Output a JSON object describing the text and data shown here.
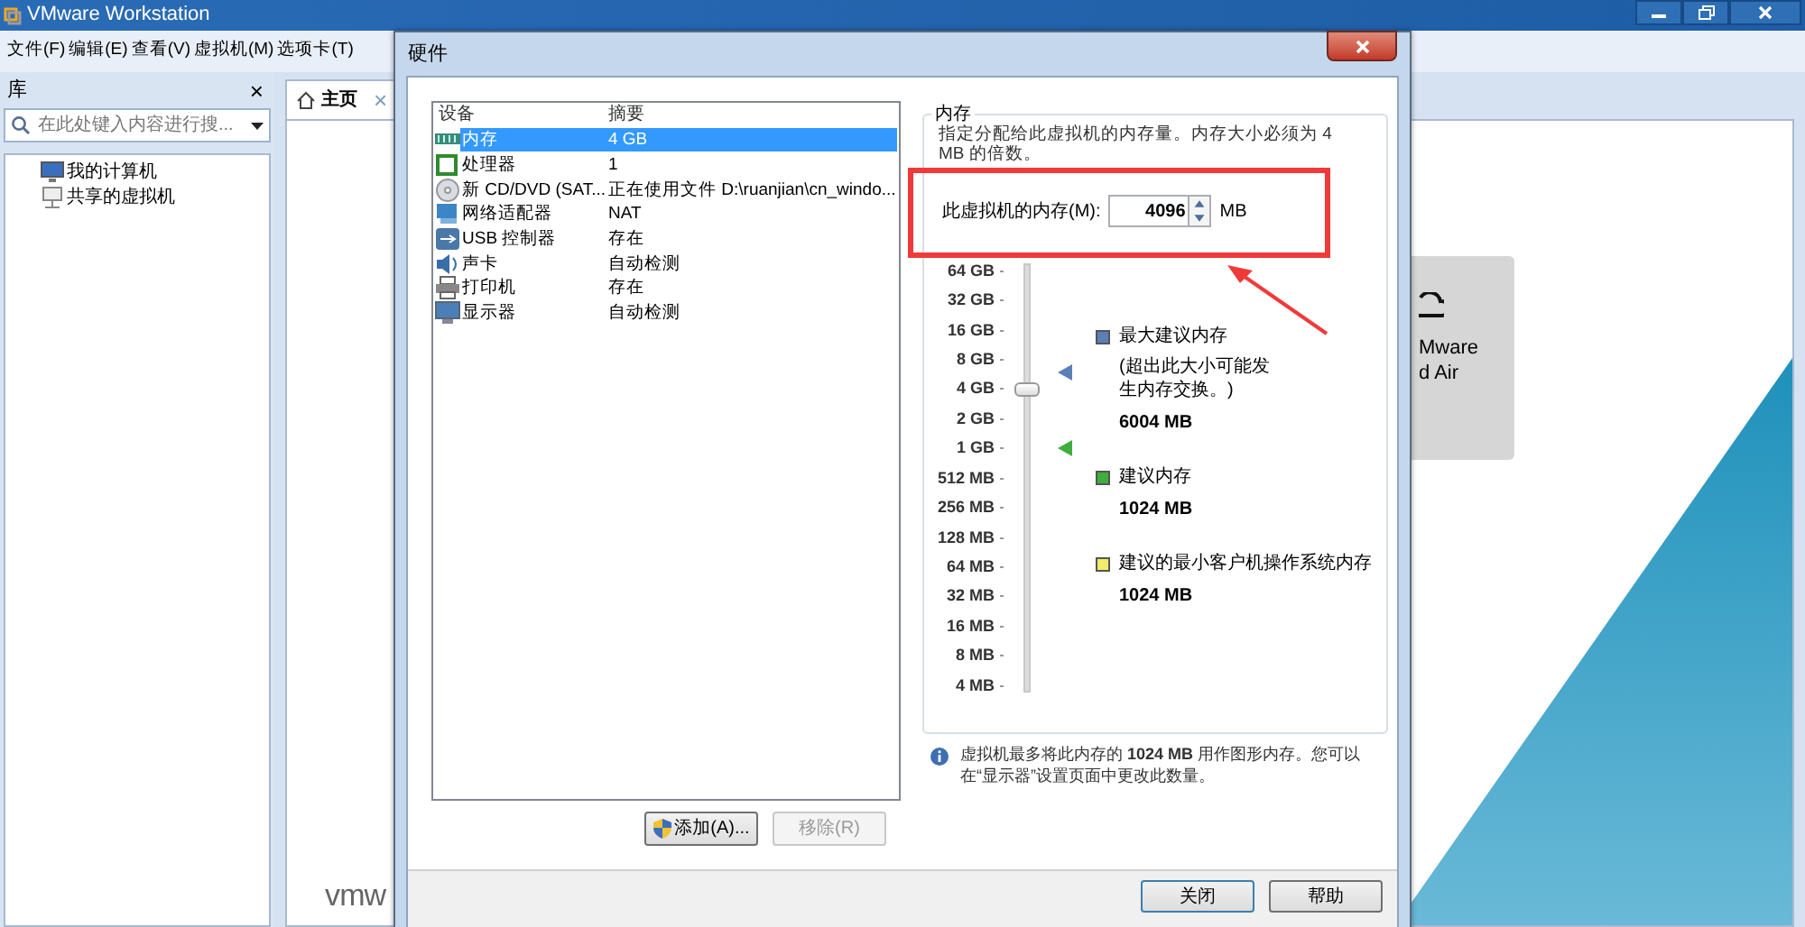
{
  "app_window": {
    "title": "VMware Workstation",
    "menu": [
      "文件(F)",
      "编辑(E)",
      "查看(V)",
      "虚拟机(M)",
      "选项卡(T)"
    ]
  },
  "library": {
    "title": "库",
    "close": "×",
    "search_placeholder": "在此处键入内容进行搜...",
    "tree": [
      {
        "label": "我的计算机",
        "kind": "computer"
      },
      {
        "label": "共享的虚拟机",
        "kind": "shared"
      }
    ]
  },
  "tabs": [
    {
      "label": "主页",
      "selected": true,
      "close": "×"
    }
  ],
  "home": {
    "card_lines": [
      "Mware",
      "d Air"
    ],
    "logo": "vmw"
  },
  "dialog": {
    "title": "硬件",
    "columns": [
      "设备",
      "摘要"
    ],
    "devices": [
      {
        "name": "内存",
        "summary": "4 GB",
        "kind": "memory",
        "selected": true
      },
      {
        "name": "处理器",
        "summary": "1",
        "kind": "cpu",
        "selected": false
      },
      {
        "name": "新 CD/DVD (SAT...",
        "summary": "正在使用文件 D:\\ruanjian\\cn_windo...",
        "kind": "cd",
        "selected": false
      },
      {
        "name": "网络适配器",
        "summary": "NAT",
        "kind": "network",
        "selected": false
      },
      {
        "name": "USB 控制器",
        "summary": "存在",
        "kind": "usb",
        "selected": false
      },
      {
        "name": "声卡",
        "summary": "自动检测",
        "kind": "sound",
        "selected": false
      },
      {
        "name": "打印机",
        "summary": "存在",
        "kind": "printer",
        "selected": false
      },
      {
        "name": "显示器",
        "summary": "自动检测",
        "kind": "display",
        "selected": false
      }
    ],
    "list_buttons": [
      {
        "label": "添加(A)...",
        "disabled": false,
        "shield": true
      },
      {
        "label": "移除(R)",
        "disabled": true,
        "shield": false
      }
    ],
    "memory": {
      "group_title": "内存",
      "description": "指定分配给此虚拟机的内存量。内存大小必须为 4 MB 的倍数。",
      "field_label": "此虚拟机的内存(M):",
      "value": "4096",
      "unit": "MB",
      "scale": [
        "64 GB",
        "32 GB",
        "16 GB",
        "8 GB",
        "4 GB",
        "2 GB",
        "1 GB",
        "512 MB",
        "256 MB",
        "128 MB",
        "64 MB",
        "32 MB",
        "16 MB",
        "8 MB",
        "4 MB"
      ],
      "level": 0.714,
      "legend": [
        {
          "color": "#5b80b8",
          "title": "最大建议内存",
          "note": "(超出此大小可能发生内存交换。)",
          "value": "6004 MB",
          "level": 0.755
        },
        {
          "color": "#3fae3f",
          "title": "建议内存",
          "value": "1024 MB",
          "level": 0.571
        },
        {
          "color": "#f2ec6a",
          "title": "建议的最小客户机操作系统内存",
          "value": "1024 MB"
        }
      ],
      "info": "虚拟机最多将此内存的 **1024 MB** 用作图形内存。您可以在“显示器”设置页面中更改此数量。"
    },
    "footer_buttons": [
      "关闭",
      "帮助"
    ]
  }
}
